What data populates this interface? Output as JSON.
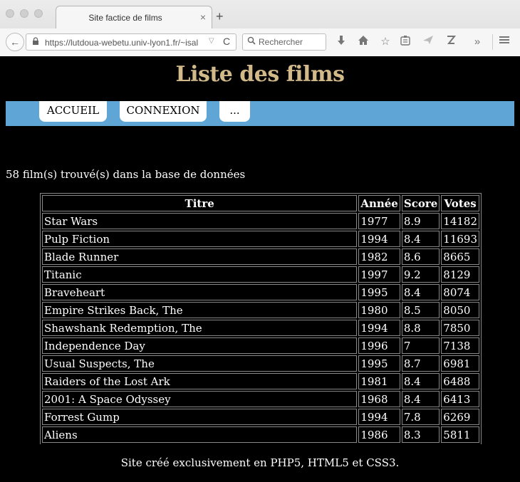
{
  "browser": {
    "tab_title": "Site factice de films",
    "tab_close": "×",
    "new_tab": "+",
    "url": "https://lutdoua-webetu.univ-lyon1.fr/~isal",
    "search_placeholder": "Rechercher",
    "back": "←",
    "reload": "C"
  },
  "page": {
    "title": "Liste des films",
    "nav": [
      "ACCUEIL",
      "CONNEXION",
      "..."
    ],
    "count_text": "58 film(s) trouvé(s) dans la base de données",
    "footer": "Site créé exclusivement en PHP5, HTML5 et CSS3."
  },
  "table": {
    "headers": [
      "Titre",
      "Année",
      "Score",
      "Votes"
    ],
    "rows": [
      [
        "Star Wars",
        "1977",
        "8.9",
        "14182"
      ],
      [
        "Pulp Fiction",
        "1994",
        "8.4",
        "11693"
      ],
      [
        "Blade Runner",
        "1982",
        "8.6",
        "8665"
      ],
      [
        "Titanic",
        "1997",
        "9.2",
        "8129"
      ],
      [
        "Braveheart",
        "1995",
        "8.4",
        "8074"
      ],
      [
        "Empire Strikes Back, The",
        "1980",
        "8.5",
        "8050"
      ],
      [
        "Shawshank Redemption, The",
        "1994",
        "8.8",
        "7850"
      ],
      [
        "Independence Day",
        "1996",
        "7",
        "7138"
      ],
      [
        "Usual Suspects, The",
        "1995",
        "8.7",
        "6981"
      ],
      [
        "Raiders of the Lost Ark",
        "1981",
        "8.4",
        "6488"
      ],
      [
        "2001: A Space Odyssey",
        "1968",
        "8.4",
        "6413"
      ],
      [
        "Forrest Gump",
        "1994",
        "7.8",
        "6269"
      ],
      [
        "Aliens",
        "1986",
        "8.3",
        "5811"
      ]
    ]
  }
}
